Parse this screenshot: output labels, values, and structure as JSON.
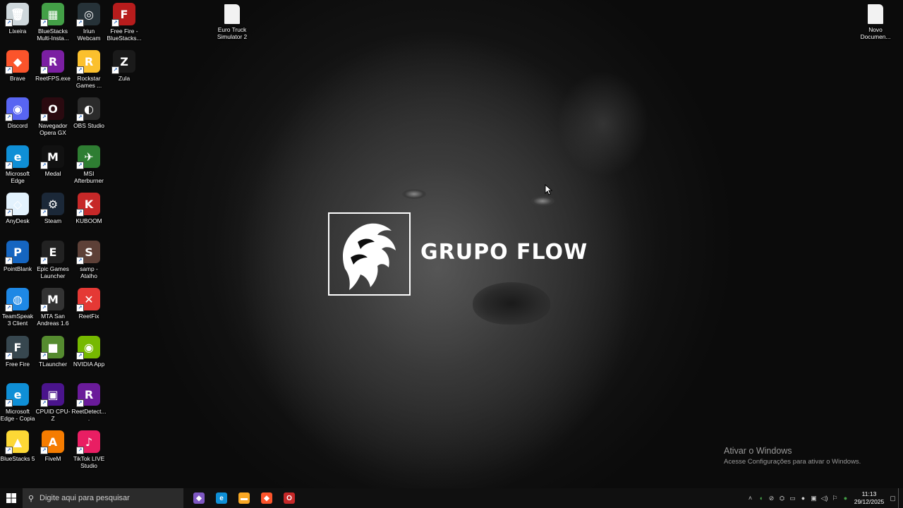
{
  "desktop_icons": [
    {
      "label": "Lixeira",
      "icon": "recycle-bin-icon",
      "color": "#cfd8dc",
      "glyph": "🗑"
    },
    {
      "label": "BlueStacks Multi-Insta...",
      "icon": "bluestacks-multi-icon",
      "color": "#43a047",
      "glyph": "▦"
    },
    {
      "label": "Iriun Webcam",
      "icon": "iriun-webcam-icon",
      "color": "#263238",
      "glyph": "◎"
    },
    {
      "label": "Free Fire - BlueStacks...",
      "icon": "free-fire-bluestacks-icon",
      "color": "#b71c1c",
      "glyph": "F"
    },
    {
      "label": "Brave",
      "icon": "brave-icon",
      "color": "#fb542b",
      "glyph": "◆"
    },
    {
      "label": "ReetFPS.exe",
      "icon": "reetfps-icon",
      "color": "#7b1fa2",
      "glyph": "R"
    },
    {
      "label": "Rockstar Games ...",
      "icon": "rockstar-icon",
      "color": "#fbc02d",
      "glyph": "R"
    },
    {
      "label": "Zula",
      "icon": "zula-icon",
      "color": "#1a1a1a",
      "glyph": "Z"
    },
    {
      "label": "Discord",
      "icon": "discord-icon",
      "color": "#5865f2",
      "glyph": "◉"
    },
    {
      "label": "Navegador Opera GX",
      "icon": "opera-gx-icon",
      "color": "#2a0a10",
      "glyph": "O"
    },
    {
      "label": "OBS Studio",
      "icon": "obs-icon",
      "color": "#2b2b2b",
      "glyph": "◐"
    },
    {
      "label": "Microsoft Edge",
      "icon": "edge-icon",
      "color": "#0f8fd6",
      "glyph": "e"
    },
    {
      "label": "Medal",
      "icon": "medal-icon",
      "color": "#111111",
      "glyph": "M"
    },
    {
      "label": "MSI Afterburner",
      "icon": "msi-afterburner-icon",
      "color": "#2e7d32",
      "glyph": "✈"
    },
    {
      "label": "AnyDesk",
      "icon": "anydesk-icon",
      "color": "#e3f2fd",
      "glyph": "◇"
    },
    {
      "label": "Steam",
      "icon": "steam-icon",
      "color": "#1b2838",
      "glyph": "⚙"
    },
    {
      "label": "KUBOOM",
      "icon": "kuboom-icon",
      "color": "#c62828",
      "glyph": "K"
    },
    {
      "label": "PointBlank",
      "icon": "pointblank-icon",
      "color": "#1565c0",
      "glyph": "P"
    },
    {
      "label": "Epic Games Launcher",
      "icon": "epic-games-icon",
      "color": "#222222",
      "glyph": "E"
    },
    {
      "label": "samp - Atalho",
      "icon": "samp-icon",
      "color": "#5d4037",
      "glyph": "S"
    },
    {
      "label": "TeamSpeak 3 Client",
      "icon": "teamspeak-icon",
      "color": "#1e88e5",
      "glyph": "◍"
    },
    {
      "label": "MTA San Andreas 1.6",
      "icon": "mta-icon",
      "color": "#333333",
      "glyph": "M"
    },
    {
      "label": "ReetFix",
      "icon": "reetfix-icon",
      "color": "#e53935",
      "glyph": "✕"
    },
    {
      "label": "Free Fire",
      "icon": "free-fire-icon",
      "color": "#37474f",
      "glyph": "F"
    },
    {
      "label": "TLauncher",
      "icon": "tlauncher-icon",
      "color": "#558b2f",
      "glyph": "■"
    },
    {
      "label": "NVIDIA App",
      "icon": "nvidia-icon",
      "color": "#76b900",
      "glyph": "◉"
    },
    {
      "label": "Microsoft Edge - Copia",
      "icon": "edge-copy-icon",
      "color": "#0f8fd6",
      "glyph": "e"
    },
    {
      "label": "CPUID CPU-Z",
      "icon": "cpuz-icon",
      "color": "#4a148c",
      "glyph": "▣"
    },
    {
      "label": "ReetDetect....",
      "icon": "reetdetect-icon",
      "color": "#6a1b9a",
      "glyph": "R"
    },
    {
      "label": "BlueStacks 5",
      "icon": "bluestacks5-icon",
      "color": "#fdd835",
      "glyph": "▲"
    },
    {
      "label": "FiveM",
      "icon": "fivem-icon",
      "color": "#f57c00",
      "glyph": "A"
    },
    {
      "label": "TikTok LIVE Studio",
      "icon": "tiktok-live-icon",
      "color": "#e91e63",
      "glyph": "♪"
    }
  ],
  "loose_icons": [
    {
      "label": "Euro Truck Simulator 2",
      "icon": "file-icon"
    },
    {
      "label": "Novo Documen...",
      "icon": "file-icon"
    }
  ],
  "logo": {
    "text": "GRUPO FLOW"
  },
  "activation": {
    "title": "Ativar o Windows",
    "subtitle": "Acesse Configurações para ativar o Windows."
  },
  "taskbar": {
    "search_placeholder": "Digite aqui para pesquisar",
    "apps": [
      {
        "icon": "copilot-icon",
        "color": "#7e57c2",
        "glyph": "◆"
      },
      {
        "icon": "edge-icon",
        "color": "#0f8fd6",
        "glyph": "e"
      },
      {
        "icon": "file-explorer-icon",
        "color": "#f9a825",
        "glyph": "▬"
      },
      {
        "icon": "brave-icon",
        "color": "#fb542b",
        "glyph": "◆"
      },
      {
        "icon": "opera-gx-icon",
        "color": "#c62828",
        "glyph": "O"
      }
    ],
    "clock_time": "11:13",
    "clock_date": "29/12/2025"
  }
}
